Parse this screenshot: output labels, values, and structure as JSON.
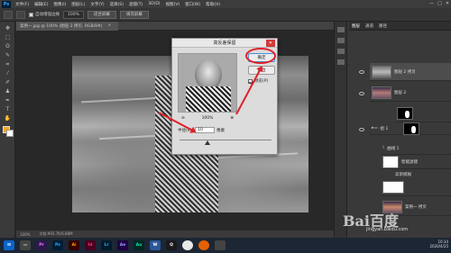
{
  "menubar": {
    "logo": "Ps",
    "items": [
      "文件(F)",
      "编辑(E)",
      "图像(I)",
      "图层(L)",
      "文字(Y)",
      "选择(S)",
      "滤镜(T)",
      "3D(D)",
      "视图(V)",
      "窗口(W)",
      "帮助(H)"
    ],
    "controls": [
      "—",
      "□",
      "✕"
    ]
  },
  "options": {
    "auto_enhance": "自动增强边缘",
    "zoom": "100%",
    "fit_btn": "适合屏幕",
    "fill_btn": "填充屏幕"
  },
  "document": {
    "tab_title": "案例一.jpg @ 100% (图层 2 拷贝, RGB/8#)",
    "close": "×",
    "zoom_status": "100%",
    "doc_size": "文档:993.7K/6.88M"
  },
  "dialog": {
    "title": "高反差保留",
    "close": "✕",
    "ok": "确定",
    "reset": "复位",
    "preview_label": "预览(P)",
    "zoom_out": "⊖",
    "zoom_level": "100%",
    "zoom_in": "⊕",
    "radius_label": "半径(R):",
    "radius_value": "10",
    "radius_unit": "像素"
  },
  "panel": {
    "tabs": [
      "图层",
      "通道",
      "路径"
    ],
    "layers": [
      {
        "name": "图层 2 拷贝"
      },
      {
        "name": "图层 2"
      },
      {
        "name": ""
      },
      {
        "name": "组 1"
      },
      {
        "name": "曲线 1"
      },
      {
        "name": "智能滤镜"
      },
      {
        "name": "高斯模糊"
      },
      {
        "name": ""
      },
      {
        "name": "案例一 拷贝"
      }
    ]
  },
  "taskbar": {
    "apps": [
      "Pr",
      "Ps",
      "Ai",
      "Id",
      "Lr",
      "Ae",
      "Au",
      "W",
      "Q"
    ],
    "time": "10:34",
    "date": "2020/4/25"
  },
  "watermark": {
    "brand": "Bai百度",
    "url": "jingyan.baidu.com"
  }
}
